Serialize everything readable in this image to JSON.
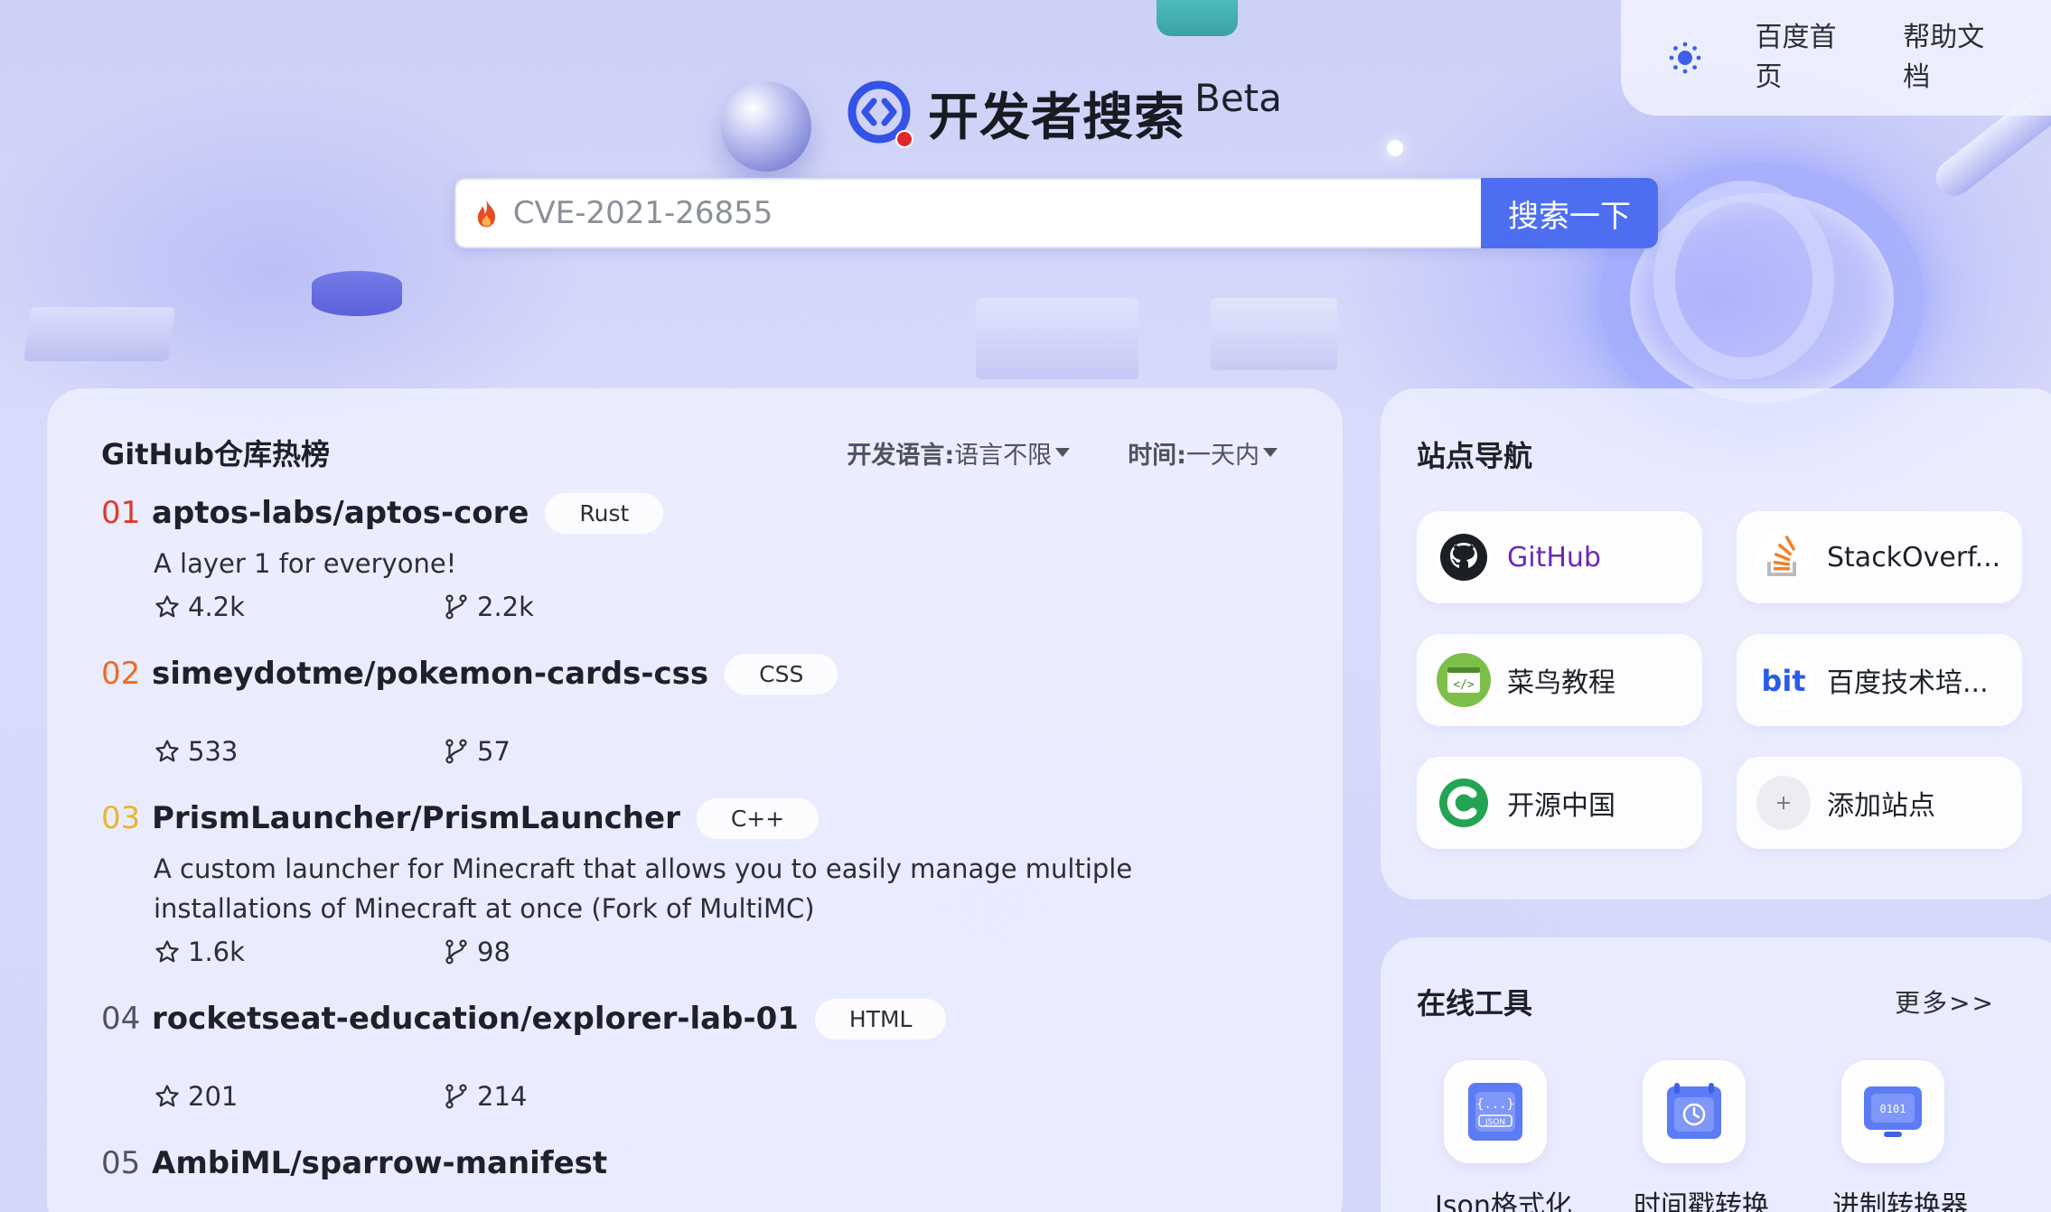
{
  "header": {
    "links": [
      "百度首页",
      "帮助文档"
    ],
    "logo_text": "开发者搜索",
    "logo_beta": "Beta"
  },
  "search": {
    "placeholder": "CVE-2021-26855",
    "button_label": "搜索一下"
  },
  "github": {
    "title": "GitHub仓库热榜",
    "filters": [
      {
        "label": "开发语言:",
        "value": "语言不限"
      },
      {
        "label": "时间:",
        "value": "一天内"
      }
    ],
    "repos": [
      {
        "rank": "01",
        "name": "aptos-labs/aptos-core",
        "lang": "Rust",
        "desc": "A layer 1 for everyone!",
        "stars": "4.2k",
        "forks": "2.2k"
      },
      {
        "rank": "02",
        "name": "simeydotme/pokemon-cards-css",
        "lang": "CSS",
        "desc": "",
        "stars": "533",
        "forks": "57"
      },
      {
        "rank": "03",
        "name": "PrismLauncher/PrismLauncher",
        "lang": "C++",
        "desc": "A custom launcher for Minecraft that allows you to easily manage multiple installations of Minecraft at once (Fork of MultiMC)",
        "stars": "1.6k",
        "forks": "98"
      },
      {
        "rank": "04",
        "name": "rocketseat-education/explorer-lab-01",
        "lang": "HTML",
        "desc": "",
        "stars": "201",
        "forks": "214"
      },
      {
        "rank": "05",
        "name": "AmbiML/sparrow-manifest",
        "lang": "",
        "desc": "",
        "stars": "",
        "forks": ""
      }
    ],
    "rank_colors": [
      "#e0382c",
      "#ef6a23",
      "#e7b62f",
      "#4e535c",
      "#4e535c"
    ]
  },
  "nav": {
    "title": "站点导航",
    "sites": [
      {
        "label": "GitHub",
        "icon": "github-icon"
      },
      {
        "label": "StackOverf...",
        "icon": "stackoverflow-icon"
      },
      {
        "label": "菜鸟教程",
        "icon": "runoob-icon"
      },
      {
        "label": "百度技术培...",
        "icon": "bit-icon"
      },
      {
        "label": "开源中国",
        "icon": "oschina-icon"
      },
      {
        "label": "添加站点",
        "icon": "plus-icon"
      }
    ]
  },
  "tools": {
    "title": "在线工具",
    "more": "更多>>",
    "items": [
      {
        "label": "Json格式化",
        "icon": "json-icon"
      },
      {
        "label": "时间戳转换",
        "icon": "timestamp-icon"
      },
      {
        "label": "进制转换器",
        "icon": "radix-icon"
      }
    ]
  },
  "colors": {
    "accent": "#4e6ef2",
    "github_link": "#6a28b8"
  }
}
